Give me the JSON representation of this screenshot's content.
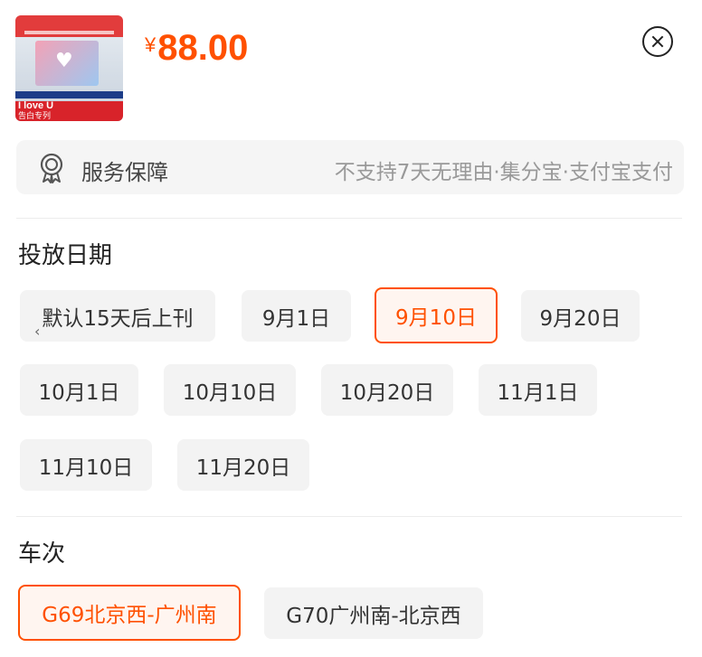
{
  "product": {
    "thumbnail_banner_line1": "I love U",
    "thumbnail_banner_line2": "告白专列",
    "price_currency": "¥",
    "price_amount": "88.00"
  },
  "service": {
    "label": "服务保障",
    "value": "不支持7天无理由·集分宝·支付宝支付"
  },
  "date_section": {
    "title": "投放日期",
    "options": [
      "默认15天后上刊",
      "9月1日",
      "9月10日",
      "9月20日",
      "10月1日",
      "10月10日",
      "10月20日",
      "11月1日",
      "11月10日",
      "11月20日"
    ],
    "selected": "9月10日"
  },
  "train_section": {
    "title": "车次",
    "options": [
      "G69北京西-广州南",
      "G70广州南-北京西"
    ],
    "selected": "G69北京西-广州南"
  },
  "colors": {
    "accent": "#ff5000",
    "chip_bg": "#f3f3f3",
    "service_bg": "#f5f5f5"
  }
}
